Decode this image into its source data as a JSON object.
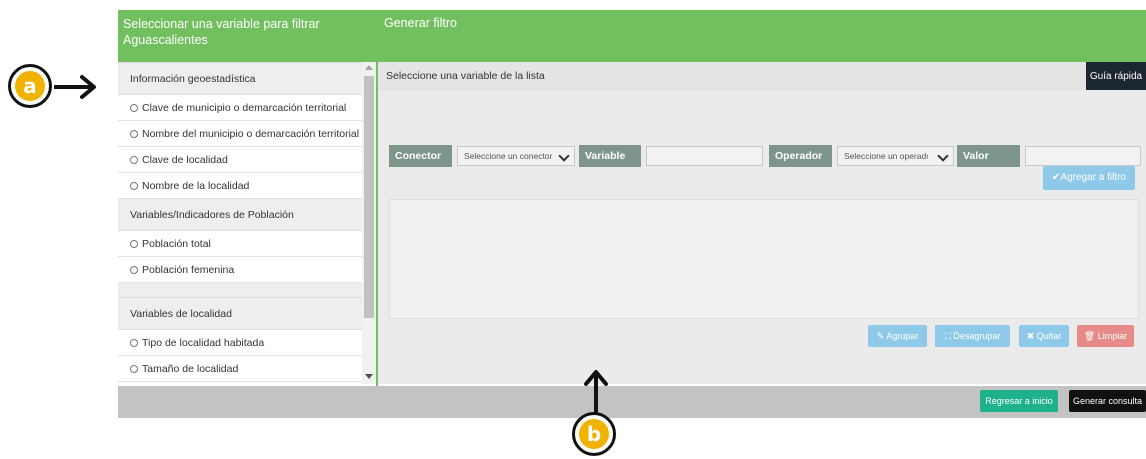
{
  "header": {
    "left_title": "Seleccionar una variable para filtrar Aguascalientes",
    "right_title": "Generar filtro"
  },
  "variable_list": {
    "categories": [
      {
        "label": "Información geoestadística",
        "items": [
          "Clave de municipio o demarcación territorial",
          "Nombre del municipio o demarcación territorial",
          "Clave de localidad",
          "Nombre de la localidad"
        ]
      },
      {
        "label": "Variables/Indicadores de Población",
        "items": [
          "Población total",
          "Población femenina"
        ]
      },
      {
        "label": "Variables de localidad",
        "items": [
          "Tipo de localidad habitada",
          "Tamaño de localidad"
        ]
      }
    ]
  },
  "filter": {
    "prompt": "Seleccione una variable de la lista",
    "guide_button": "Guía rápida",
    "conector_label": "Conector",
    "conector_select": "Seleccione un conector",
    "variable_label": "Variable",
    "variable_value": "",
    "operador_label": "Operador",
    "operador_select": "Seleccione un operador",
    "valor_label": "Valor",
    "valor_value": "",
    "add_button": "✔Agregar a filtro",
    "actions": {
      "group": "Agrupar",
      "ungroup": "Desagrupar",
      "remove": "Quitar",
      "clear": "Limpiar"
    }
  },
  "footer": {
    "back_button": "Regresar a inicio",
    "generate_button": "Generar consulta"
  },
  "annotations": {
    "a": "a",
    "b": "b"
  },
  "colors": {
    "header_green": "#72bf5f",
    "label_gray_green": "#7d958a",
    "add_button_blue": "#8fc9ea",
    "clear_button_red": "#e78a8a",
    "back_button_teal": "#1fb08c",
    "annotation_yellow": "#f0b400"
  }
}
